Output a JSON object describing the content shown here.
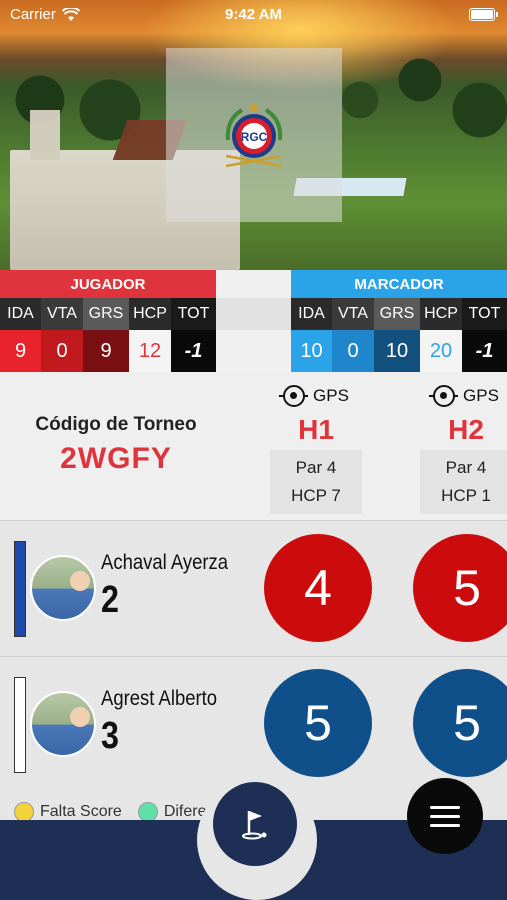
{
  "status_bar": {
    "carrier": "Carrier",
    "time": "9:42 AM"
  },
  "logo": {
    "text": "RGC"
  },
  "jugador": {
    "header": "JUGADOR",
    "columns": [
      "IDA",
      "VTA",
      "GRS",
      "HCP",
      "TOT"
    ],
    "values": [
      "9",
      "0",
      "9",
      "12",
      "-1"
    ]
  },
  "marcador": {
    "header": "MARCADOR",
    "columns": [
      "IDA",
      "VTA",
      "GRS",
      "HCP",
      "TOT"
    ],
    "values": [
      "10",
      "0",
      "10",
      "20",
      "-1"
    ]
  },
  "torneo": {
    "label": "Código de Torneo",
    "code": "2WGFY"
  },
  "holes": [
    {
      "gps": "GPS",
      "hole": "H1",
      "par": "Par 4",
      "hcp": "HCP 7"
    },
    {
      "gps": "GPS",
      "hole": "H2",
      "par": "Par 4",
      "hcp": "HCP 1"
    }
  ],
  "players": [
    {
      "name": "Achaval Ayerza",
      "hcp": "2",
      "scores": [
        "4",
        "5"
      ]
    },
    {
      "name": "Agrest Alberto",
      "hcp": "3",
      "scores": [
        "5",
        "5"
      ]
    }
  ],
  "legend": [
    {
      "label": "Falta Score",
      "color": "#f2d43a"
    },
    {
      "label": "Diferen",
      "color": "#5fe0a8"
    }
  ],
  "colors": {
    "red": "#e0343d",
    "blue": "#2aa3e8",
    "score_red": "#cc0c0c",
    "score_blue": "#0f4f8a",
    "navy": "#1e2f55"
  }
}
